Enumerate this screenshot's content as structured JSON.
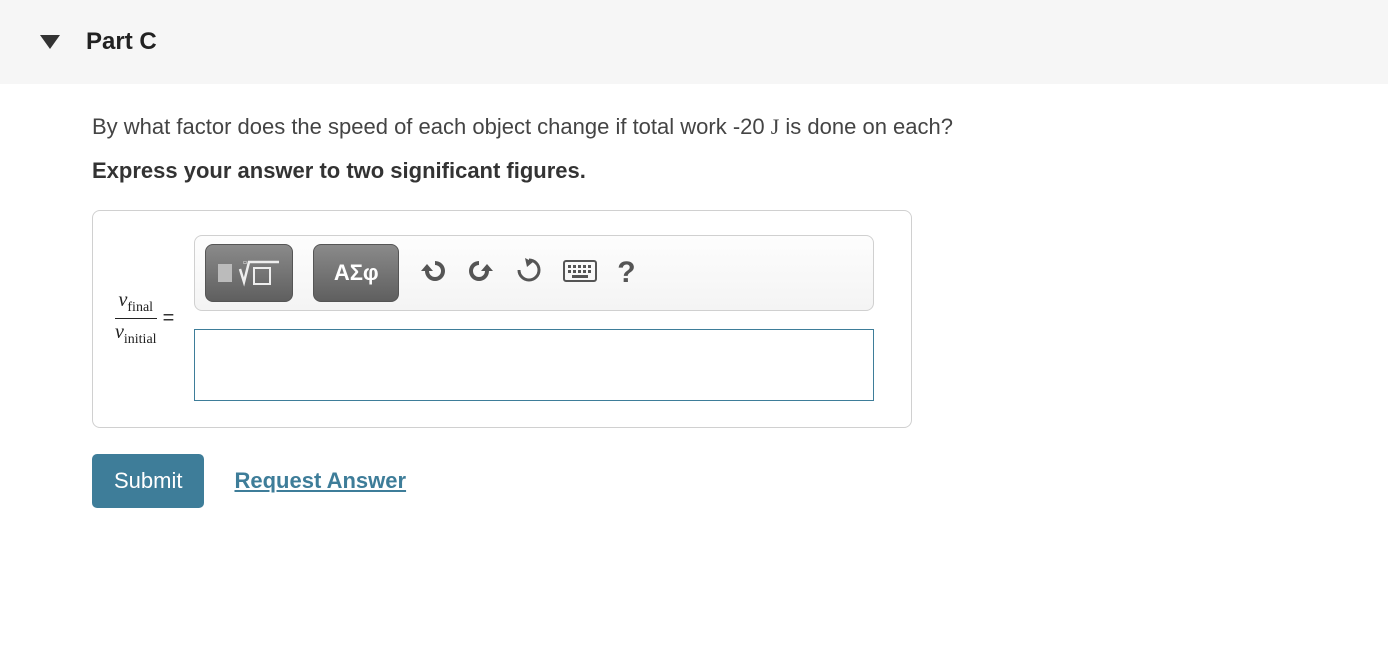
{
  "header": {
    "title": "Part C"
  },
  "question": {
    "prefix": "By what factor does the speed of each object change if total work -20 ",
    "unit": "J",
    "suffix": " is done on each?"
  },
  "instruction": "Express your answer to two significant figures.",
  "toolbar": {
    "math_tools_label": "",
    "greek_label": "ΑΣφ",
    "help_label": "?"
  },
  "answer": {
    "numerator_v": "v",
    "numerator_sub": "final",
    "denominator_v": "v",
    "denominator_sub": "initial",
    "equals": "="
  },
  "actions": {
    "submit": "Submit",
    "request": "Request Answer"
  }
}
